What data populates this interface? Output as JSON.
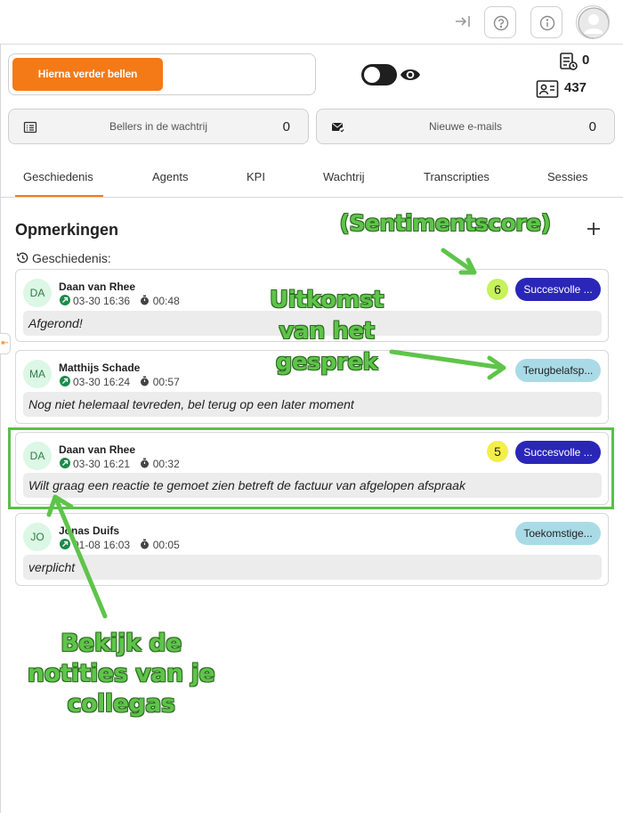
{
  "topbar": {
    "collapse_icon": "collapse-right-icon",
    "help_icon": "help-icon",
    "info_icon": "info-icon",
    "avatar_icon": "user-avatar-icon"
  },
  "call_next": {
    "label": "Hierna verder bellen",
    "color": "#f47a17"
  },
  "visibility_toggle": {
    "on": true,
    "icon": "eye-icon"
  },
  "stats": {
    "tasks": "0",
    "contacts": "437"
  },
  "queue_card": {
    "label": "Bellers in de wachtrij",
    "count": "0",
    "icon": "list-icon"
  },
  "email_card": {
    "label": "Nieuwe e-mails",
    "count": "0",
    "icon": "mail-check-icon"
  },
  "tabs": [
    {
      "label": "Geschiedenis",
      "active": true
    },
    {
      "label": "Agents"
    },
    {
      "label": "KPI"
    },
    {
      "label": "Wachtrij"
    },
    {
      "label": "Transcripties"
    },
    {
      "label": "Sessies"
    }
  ],
  "panel": {
    "title": "Opmerkingen",
    "history_label": "Geschiedenis:"
  },
  "entries": [
    {
      "initials": "DA",
      "name": "Daan van Rhee",
      "datetime": "03-30 16:36",
      "duration": "00:48",
      "score": "6",
      "score_color": "#c6f25a",
      "outcome": "Succesvolle ...",
      "outcome_type": "success",
      "note": "Afgerond!"
    },
    {
      "initials": "MA",
      "name": "Matthijs Schade",
      "datetime": "03-30 16:24",
      "duration": "00:57",
      "score": "",
      "outcome": "Terugbelafsp...",
      "outcome_type": "other",
      "note": "Nog niet helemaal tevreden, bel terug op een later moment"
    },
    {
      "initials": "DA",
      "name": "Daan van Rhee",
      "datetime": "03-30 16:21",
      "duration": "00:32",
      "score": "5",
      "score_color": "#f4ee4a",
      "outcome": "Succesvolle ...",
      "outcome_type": "success",
      "note": "Wilt graag een reactie te gemoet zien betreft de factuur van afgelopen afspraak"
    },
    {
      "initials": "JO",
      "name": "Jonas Duifs",
      "datetime": "01-08 16:03",
      "duration": "00:05",
      "score": "",
      "outcome": "Toekomstige...",
      "outcome_type": "other",
      "note": "verplicht"
    }
  ],
  "annotations": {
    "sentiment": "(Sentimentscore)",
    "outcome_lines": [
      "Uitkomst",
      "van het",
      "gesprek"
    ],
    "notes_lines": [
      "Bekijk de",
      "notities van je",
      "collegas"
    ],
    "color": "#5ec44a"
  }
}
